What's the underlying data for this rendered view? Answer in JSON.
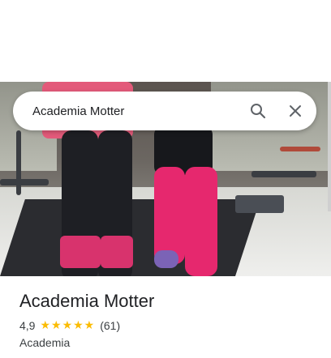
{
  "search": {
    "query": "Academia Motter",
    "search_icon": "search-icon",
    "close_icon": "close-icon"
  },
  "place": {
    "name": "Academia Motter",
    "rating": "4,9",
    "rating_value": 4.9,
    "stars": "★★★★★",
    "review_count": "(61)",
    "category": "Academia"
  },
  "colors": {
    "star": "#fbbc04",
    "leggings_pink": "#e6286e",
    "mat": "#2b2c30"
  }
}
